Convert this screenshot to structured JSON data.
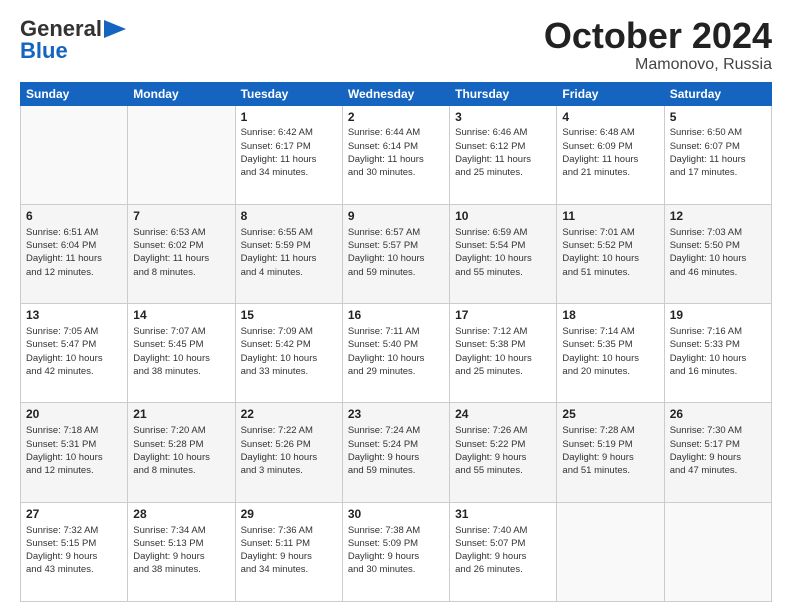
{
  "logo": {
    "line1": "General",
    "line2": "Blue"
  },
  "title": "October 2024",
  "location": "Mamonovo, Russia",
  "weekdays": [
    "Sunday",
    "Monday",
    "Tuesday",
    "Wednesday",
    "Thursday",
    "Friday",
    "Saturday"
  ],
  "weeks": [
    [
      {
        "day": "",
        "info": ""
      },
      {
        "day": "",
        "info": ""
      },
      {
        "day": "1",
        "info": "Sunrise: 6:42 AM\nSunset: 6:17 PM\nDaylight: 11 hours\nand 34 minutes."
      },
      {
        "day": "2",
        "info": "Sunrise: 6:44 AM\nSunset: 6:14 PM\nDaylight: 11 hours\nand 30 minutes."
      },
      {
        "day": "3",
        "info": "Sunrise: 6:46 AM\nSunset: 6:12 PM\nDaylight: 11 hours\nand 25 minutes."
      },
      {
        "day": "4",
        "info": "Sunrise: 6:48 AM\nSunset: 6:09 PM\nDaylight: 11 hours\nand 21 minutes."
      },
      {
        "day": "5",
        "info": "Sunrise: 6:50 AM\nSunset: 6:07 PM\nDaylight: 11 hours\nand 17 minutes."
      }
    ],
    [
      {
        "day": "6",
        "info": "Sunrise: 6:51 AM\nSunset: 6:04 PM\nDaylight: 11 hours\nand 12 minutes."
      },
      {
        "day": "7",
        "info": "Sunrise: 6:53 AM\nSunset: 6:02 PM\nDaylight: 11 hours\nand 8 minutes."
      },
      {
        "day": "8",
        "info": "Sunrise: 6:55 AM\nSunset: 5:59 PM\nDaylight: 11 hours\nand 4 minutes."
      },
      {
        "day": "9",
        "info": "Sunrise: 6:57 AM\nSunset: 5:57 PM\nDaylight: 10 hours\nand 59 minutes."
      },
      {
        "day": "10",
        "info": "Sunrise: 6:59 AM\nSunset: 5:54 PM\nDaylight: 10 hours\nand 55 minutes."
      },
      {
        "day": "11",
        "info": "Sunrise: 7:01 AM\nSunset: 5:52 PM\nDaylight: 10 hours\nand 51 minutes."
      },
      {
        "day": "12",
        "info": "Sunrise: 7:03 AM\nSunset: 5:50 PM\nDaylight: 10 hours\nand 46 minutes."
      }
    ],
    [
      {
        "day": "13",
        "info": "Sunrise: 7:05 AM\nSunset: 5:47 PM\nDaylight: 10 hours\nand 42 minutes."
      },
      {
        "day": "14",
        "info": "Sunrise: 7:07 AM\nSunset: 5:45 PM\nDaylight: 10 hours\nand 38 minutes."
      },
      {
        "day": "15",
        "info": "Sunrise: 7:09 AM\nSunset: 5:42 PM\nDaylight: 10 hours\nand 33 minutes."
      },
      {
        "day": "16",
        "info": "Sunrise: 7:11 AM\nSunset: 5:40 PM\nDaylight: 10 hours\nand 29 minutes."
      },
      {
        "day": "17",
        "info": "Sunrise: 7:12 AM\nSunset: 5:38 PM\nDaylight: 10 hours\nand 25 minutes."
      },
      {
        "day": "18",
        "info": "Sunrise: 7:14 AM\nSunset: 5:35 PM\nDaylight: 10 hours\nand 20 minutes."
      },
      {
        "day": "19",
        "info": "Sunrise: 7:16 AM\nSunset: 5:33 PM\nDaylight: 10 hours\nand 16 minutes."
      }
    ],
    [
      {
        "day": "20",
        "info": "Sunrise: 7:18 AM\nSunset: 5:31 PM\nDaylight: 10 hours\nand 12 minutes."
      },
      {
        "day": "21",
        "info": "Sunrise: 7:20 AM\nSunset: 5:28 PM\nDaylight: 10 hours\nand 8 minutes."
      },
      {
        "day": "22",
        "info": "Sunrise: 7:22 AM\nSunset: 5:26 PM\nDaylight: 10 hours\nand 3 minutes."
      },
      {
        "day": "23",
        "info": "Sunrise: 7:24 AM\nSunset: 5:24 PM\nDaylight: 9 hours\nand 59 minutes."
      },
      {
        "day": "24",
        "info": "Sunrise: 7:26 AM\nSunset: 5:22 PM\nDaylight: 9 hours\nand 55 minutes."
      },
      {
        "day": "25",
        "info": "Sunrise: 7:28 AM\nSunset: 5:19 PM\nDaylight: 9 hours\nand 51 minutes."
      },
      {
        "day": "26",
        "info": "Sunrise: 7:30 AM\nSunset: 5:17 PM\nDaylight: 9 hours\nand 47 minutes."
      }
    ],
    [
      {
        "day": "27",
        "info": "Sunrise: 7:32 AM\nSunset: 5:15 PM\nDaylight: 9 hours\nand 43 minutes."
      },
      {
        "day": "28",
        "info": "Sunrise: 7:34 AM\nSunset: 5:13 PM\nDaylight: 9 hours\nand 38 minutes."
      },
      {
        "day": "29",
        "info": "Sunrise: 7:36 AM\nSunset: 5:11 PM\nDaylight: 9 hours\nand 34 minutes."
      },
      {
        "day": "30",
        "info": "Sunrise: 7:38 AM\nSunset: 5:09 PM\nDaylight: 9 hours\nand 30 minutes."
      },
      {
        "day": "31",
        "info": "Sunrise: 7:40 AM\nSunset: 5:07 PM\nDaylight: 9 hours\nand 26 minutes."
      },
      {
        "day": "",
        "info": ""
      },
      {
        "day": "",
        "info": ""
      }
    ]
  ]
}
